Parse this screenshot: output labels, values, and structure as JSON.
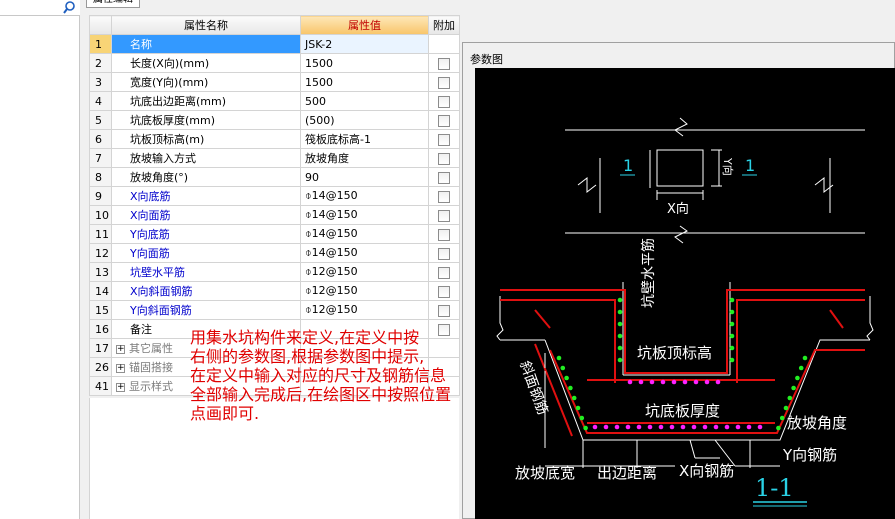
{
  "panel": {
    "tab_label": "属性编辑"
  },
  "grid": {
    "headers": {
      "name": "属性名称",
      "value": "属性值",
      "extra": "附加"
    },
    "rows": [
      {
        "num": "1",
        "name": "名称",
        "value": "JSK-2"
      },
      {
        "num": "2",
        "name": "长度(X向)(mm)",
        "value": "1500"
      },
      {
        "num": "3",
        "name": "宽度(Y向)(mm)",
        "value": "1500"
      },
      {
        "num": "4",
        "name": "坑底出边距离(mm)",
        "value": "500"
      },
      {
        "num": "5",
        "name": "坑底板厚度(mm)",
        "value": "(500)"
      },
      {
        "num": "6",
        "name": "坑板顶标高(m)",
        "value": "筏板底标高-1"
      },
      {
        "num": "7",
        "name": "放坡输入方式",
        "value": "放坡角度"
      },
      {
        "num": "8",
        "name": "放坡角度(°)",
        "value": "90"
      },
      {
        "num": "9",
        "name": "X向底筋",
        "value": "⌽14@150"
      },
      {
        "num": "10",
        "name": "X向面筋",
        "value": "⌽14@150"
      },
      {
        "num": "11",
        "name": "Y向底筋",
        "value": "⌽14@150"
      },
      {
        "num": "12",
        "name": "Y向面筋",
        "value": "⌽14@150"
      },
      {
        "num": "13",
        "name": "坑壁水平筋",
        "value": "⌽12@150"
      },
      {
        "num": "14",
        "name": "X向斜面钢筋",
        "value": "⌽12@150"
      },
      {
        "num": "15",
        "name": "Y向斜面钢筋",
        "value": "⌽12@150"
      },
      {
        "num": "16",
        "name": "备注",
        "value": ""
      }
    ],
    "groups": [
      {
        "num": "17",
        "name": "其它属性"
      },
      {
        "num": "26",
        "name": "锚固搭接"
      },
      {
        "num": "41",
        "name": "显示样式"
      }
    ]
  },
  "note": {
    "lines": [
      "用集水坑构件来定义,在定义中按",
      "右侧的参数图,根据参数图中提示,",
      "在定义中输入对应的尺寸及钢筋信息",
      "全部输入完成后,在绘图区中按照位置",
      "点画即可."
    ]
  },
  "diagram": {
    "title": "参数图",
    "plan": {
      "section_mark_left": "1",
      "section_mark_right": "1",
      "x_label": "X向",
      "y_label": "Y向"
    },
    "section": {
      "wall_horizontal_bar": "坑壁水平筋",
      "slab_top_elevation": "坑板顶标高",
      "slope_bar": "斜面钢筋",
      "slab_thickness": "坑底板厚度",
      "slope_angle": "放坡角度",
      "y_bar": "Y向钢筋",
      "slope_base_width": "放坡底宽",
      "edge_distance": "出边距离",
      "x_bar": "X向钢筋",
      "section_title": "1-1"
    }
  }
}
